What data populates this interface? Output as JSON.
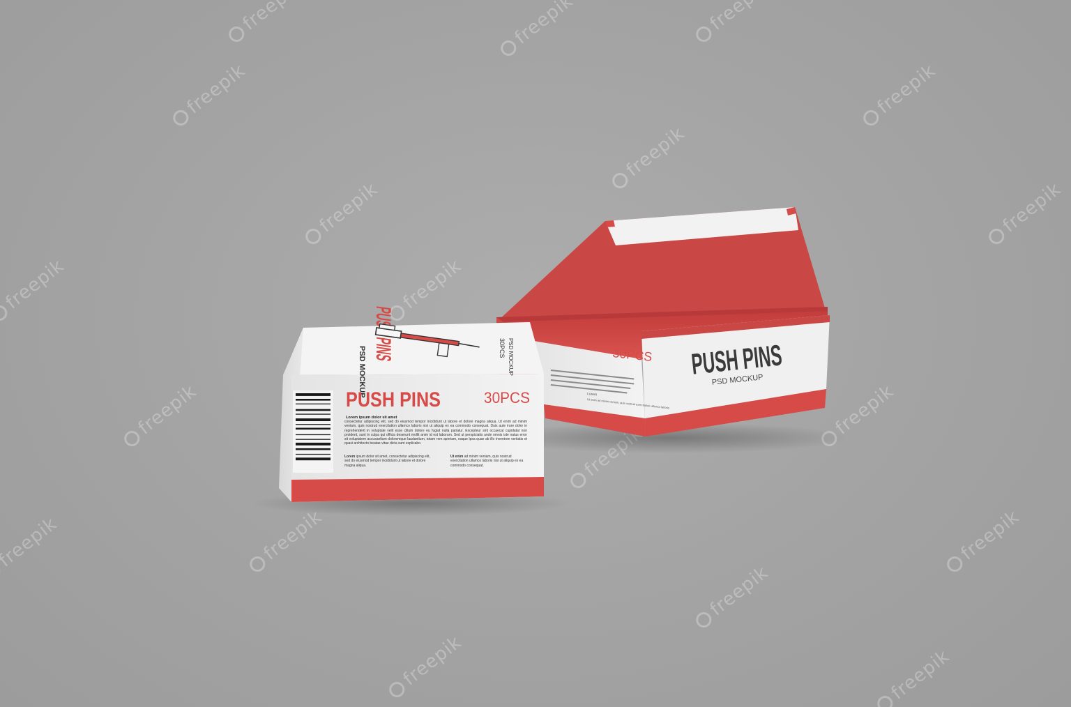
{
  "scene": {
    "background_color": "#a4a4a4",
    "brand_red": "#d64b48",
    "box_white": "#efefef"
  },
  "closed_box": {
    "front_title": "PUSH PINS",
    "front_quantity": "30PCS",
    "top_title": "PUSH PINS",
    "top_subtitle": "PSD MOCKUP",
    "top_side_text_1": "30PCS",
    "top_side_text_2": "PSD MOCKUP",
    "body_heading": "Lorem ipsum dolor sit amet",
    "body_paragraph": "consectetur adipiscing elit, sed do eiusmod tempor incididunt ut labore et dolore magna aliqua. Ut enim ad minim veniam, quis nostrud exercitation ullamco laboris nisi ut aliquip ex ea commodo consequat. Duis aute irure dolor in reprehenderit in voluptate velit esse cillum dolore eu fugiat nulla pariatur. Excepteur sint occaecat cupidatat non proident, sunt in culpa qui officia deserunt mollit anim id est laborum. Sed ut perspiciatis unde omnis iste natus error sit voluptatem accusantium doloremque laudantium, totam rem aperiam, eaque ipsa quae ab illo inventore veritatis et quasi architecto beatae vitae dicta sunt explicabo.",
    "col1_heading": "Lorem",
    "col1_text": "ipsum dolor sit amet, consectetur adipiscing elit, sed do eiusmod tempor incididunt ut labore et dolore magna aliqua.",
    "col2_heading": "Ut enim",
    "col2_text": "ad minim veniam, quis nostrud exercitation ullamco laboris nisi ut aliquip ex ea commodo consequat.",
    "barcode_icon": "barcode-icon",
    "push_pin_icon": "push-pin-icon"
  },
  "open_box": {
    "side_title": "PUSH PINS",
    "side_subtitle": "PSD MOCKUP",
    "front_partial_text": "30PCS",
    "front_text_line": "Ut enim ad minim veniam, quis nostrud exercitation ullamco laboris",
    "front_text_heading": "Lorem"
  },
  "watermark": {
    "text": "freepik",
    "icon": "freepik-logo-icon"
  }
}
